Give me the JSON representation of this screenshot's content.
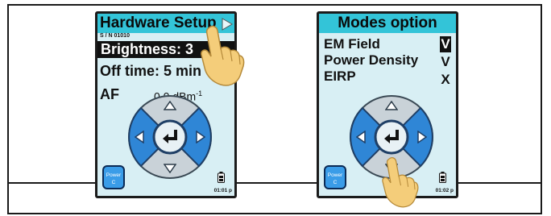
{
  "colors": {
    "title_bar": "#33c4d8",
    "screen_bg": "#d8eff4",
    "dpad_blue": "#2f86d6",
    "dpad_grey": "#c9d2d8",
    "hand": "#f4cd7a"
  },
  "screens": [
    {
      "title": "Hardware Setup",
      "title_arrow_icon": "arrow-right-icon",
      "serial": "S / N 01010",
      "rows": [
        {
          "label": "Brightness: 3",
          "selected": true
        },
        {
          "label": "Off time: 5 min",
          "selected": false
        },
        {
          "label": "AF",
          "selected": false
        }
      ],
      "af_value": "0.0 dBm",
      "af_unit_exp": "-1",
      "power_label_1": "Power",
      "power_label_2": "C",
      "time": "01:01 p",
      "hand_position": "on title arrow"
    },
    {
      "title": "Modes option",
      "modes": [
        {
          "label": "EM Field",
          "state": "V",
          "selected": true
        },
        {
          "label": "Power Density",
          "state": "V",
          "selected": false
        },
        {
          "label": "EIRP",
          "state": "X",
          "selected": false
        }
      ],
      "power_label_1": "Power",
      "power_label_2": "C",
      "time": "01:02 p",
      "hand_position": "on down button"
    }
  ]
}
